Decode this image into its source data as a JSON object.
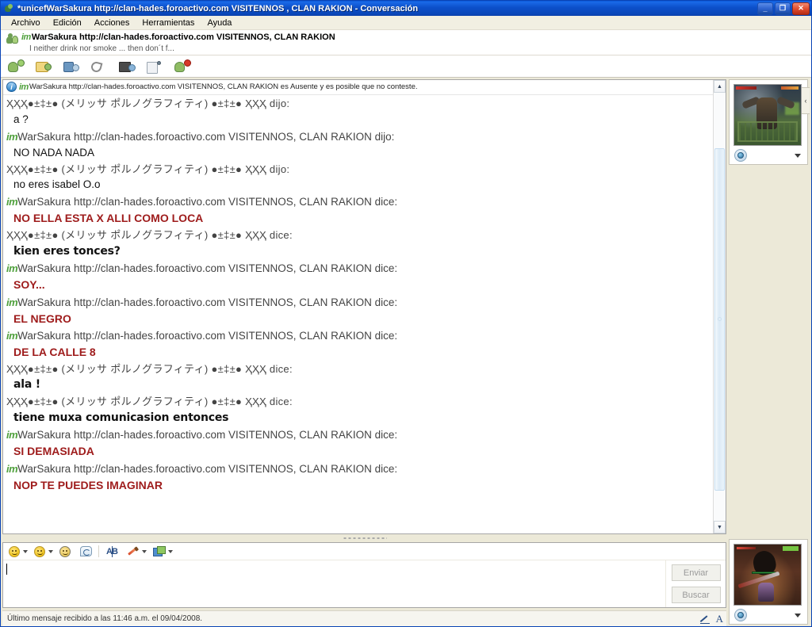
{
  "window": {
    "title": "*unicefWarSakura http://clan-hades.foroactivo.com VISITENNOS , CLAN RAKION - Conversación",
    "icon": "messenger-contact-icon",
    "controls": {
      "minimize": "_",
      "restore": "❐",
      "close": "✕"
    }
  },
  "menubar": {
    "items": [
      {
        "label": "Archivo"
      },
      {
        "label": "Edición"
      },
      {
        "label": "Acciones"
      },
      {
        "label": "Herramientas"
      },
      {
        "label": "Ayuda"
      }
    ]
  },
  "contact": {
    "im_badge": "im",
    "name": "WarSakura http://clan-hades.foroactivo.com VISITENNOS, CLAN RAKION",
    "personal_message": "I neither drink nor smoke ... then don´t f...",
    "avatar": "contact-avatar-icon"
  },
  "action_toolbar": {
    "items": [
      {
        "name": "invite-contact-icon",
        "label": "Invitar",
        "base": "#7fae5a",
        "badge": "#9ed06f"
      },
      {
        "name": "send-files-icon",
        "label": "Enviar archivos",
        "base": "#e8cf77",
        "badge": "#9ed06f"
      },
      {
        "name": "video-call-icon",
        "label": "Videollamada",
        "base": "#6a96c0",
        "badge": "#8ab4d8"
      },
      {
        "name": "voice-call-icon",
        "label": "Llamada",
        "base": "#c9c9c9",
        "badge": "#b0b0b0"
      },
      {
        "name": "video-icon",
        "label": "Vídeo",
        "base": "#5f6f7d",
        "badge": "#7fa0bd"
      },
      {
        "name": "activities-icon",
        "label": "Actividades",
        "base": "#dfe3e8",
        "badge": "#9ab4cd"
      },
      {
        "name": "block-contact-icon",
        "label": "Bloquear",
        "base": "#8fbc63",
        "badge": "#d03a2a"
      }
    ]
  },
  "chat": {
    "notice": {
      "icon": "info-icon",
      "im_badge": "im",
      "text": "WarSakura http://clan-hades.foroactivo.com VISITENNOS, CLAN RAKION es Ausente y es posible que no conteste."
    },
    "senders": {
      "melissa": "ҲҲҲ●±‡±● (メリッサ ポルノグラフィティ) ●±‡±● ҲҲҲ",
      "warsakura": "WarSakura http://clan-hades.foroactivo.com VISITENNOS, CLAN RAKION",
      "im_badge": "im"
    },
    "verb_said": "dijo:",
    "verb_says": "dice:",
    "messages": [
      {
        "sender": "melissa",
        "verb": "dijo:",
        "text": "a ?",
        "style": "plain"
      },
      {
        "sender": "warsakura",
        "verb": "dijo:",
        "text": "NO NADA NADA",
        "style": "plain"
      },
      {
        "sender": "melissa",
        "verb": "dijo:",
        "text": "no eres isabel O.o",
        "style": "plain"
      },
      {
        "sender": "warsakura",
        "verb": "dice:",
        "text": "NO ELLA ESTA X ALLI COMO LOCA",
        "style": "red"
      },
      {
        "sender": "melissa",
        "verb": "dice:",
        "text": "kien eres tonces?",
        "style": "comic"
      },
      {
        "sender": "warsakura",
        "verb": "dice:",
        "text": "SOY...",
        "style": "red"
      },
      {
        "sender": "warsakura",
        "verb": "dice:",
        "text": "EL NEGRO",
        "style": "red"
      },
      {
        "sender": "warsakura",
        "verb": "dice:",
        "text": "DE LA CALLE 8",
        "style": "red"
      },
      {
        "sender": "melissa",
        "verb": "dice:",
        "text": "ala !",
        "style": "comic"
      },
      {
        "sender": "melissa",
        "verb": "dice:",
        "text": "tiene muxa comunicasion entonces",
        "style": "comic"
      },
      {
        "sender": "warsakura",
        "verb": "dice:",
        "text": "SI DEMASIADA",
        "style": "red"
      },
      {
        "sender": "warsakura",
        "verb": "dice:",
        "text": "NOP TE PUEDES IMAGINAR",
        "style": "red"
      }
    ],
    "scrollbar": {
      "up_arrow": "▲",
      "down_arrow": "▼"
    }
  },
  "compose": {
    "format_toolbar": [
      {
        "name": "emoticon-picker-icon",
        "label": "Emoticonos"
      },
      {
        "name": "wink-picker-icon",
        "label": "Guiños"
      },
      {
        "name": "nudge-icon",
        "label": "Zumbido"
      },
      {
        "name": "voice-clip-icon",
        "label": "Clip de voz"
      },
      {
        "name": "spellcheck-icon",
        "label": "Ortografía"
      },
      {
        "name": "font-color-icon",
        "label": "Fuente"
      },
      {
        "name": "background-icon",
        "label": "Fondo"
      }
    ],
    "input_value": "",
    "input_placeholder": "",
    "send_label": "Enviar",
    "search_label": "Buscar"
  },
  "statusbar": {
    "text": "Último mensaje recibido a las 11:46 a.m. el 09/04/2008.",
    "icons": [
      {
        "name": "ink-pen-icon",
        "label": "Entrada manuscrita"
      },
      {
        "name": "font-text-icon",
        "label": "A"
      }
    ]
  },
  "sidebar": {
    "collapse_glyph": "‹",
    "contact_display_picture": {
      "name": "contact-display-picture",
      "alt": "Rakion game screenshot - winged boss",
      "camera_icon": "webcam-icon",
      "caret": "▼"
    },
    "my_display_picture": {
      "name": "my-display-picture",
      "alt": "Rakion game screenshot - player with sword",
      "camera_icon": "webcam-icon",
      "caret": "▼"
    }
  },
  "colors": {
    "title_blue": "#0a4fc9",
    "red_message": "#9e1b1b",
    "im_green": "#4fa03c",
    "window_face": "#ece9d8"
  }
}
